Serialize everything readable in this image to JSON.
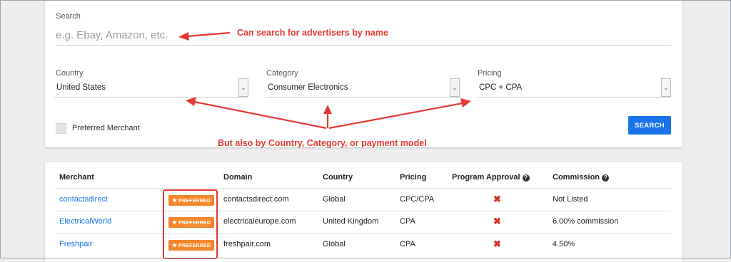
{
  "search": {
    "label": "Search",
    "placeholder": "e.g. Ebay, Amazon, etc."
  },
  "filters": {
    "country": {
      "label": "Country",
      "value": "United States"
    },
    "category": {
      "label": "Category",
      "value": "Consumer Electronics"
    },
    "pricing": {
      "label": "Pricing",
      "value": "CPC + CPA"
    }
  },
  "preferred_checkbox_label": "Preferred Merchant",
  "search_button": "SEARCH",
  "annotations": {
    "search_note": "Can search for advertisers by name",
    "filter_note": "But also by Country, Category, or payment model"
  },
  "table": {
    "headers": [
      "Merchant",
      "Domain",
      "Country",
      "Pricing",
      "Program Approval",
      "Commission"
    ],
    "badge_label": "PREFERRED",
    "rows": [
      {
        "merchant": "contactsdirect",
        "domain": "contactsdirect.com",
        "country": "Global",
        "pricing": "CPC/CPA",
        "approval": "✖",
        "commission": "Not Listed"
      },
      {
        "merchant": "ElectricalWorld",
        "domain": "electricaleurope.com",
        "country": "United Kingdom",
        "pricing": "CPA",
        "approval": "✖",
        "commission": "6.00% commission"
      },
      {
        "merchant": "Freshpair",
        "domain": "freshpair.com",
        "country": "Global",
        "pricing": "CPA",
        "approval": "✖",
        "commission": "4.50%"
      }
    ]
  },
  "colors": {
    "accent": "#1a73e8",
    "annotation": "#e53935",
    "badge": "#f4872b"
  }
}
